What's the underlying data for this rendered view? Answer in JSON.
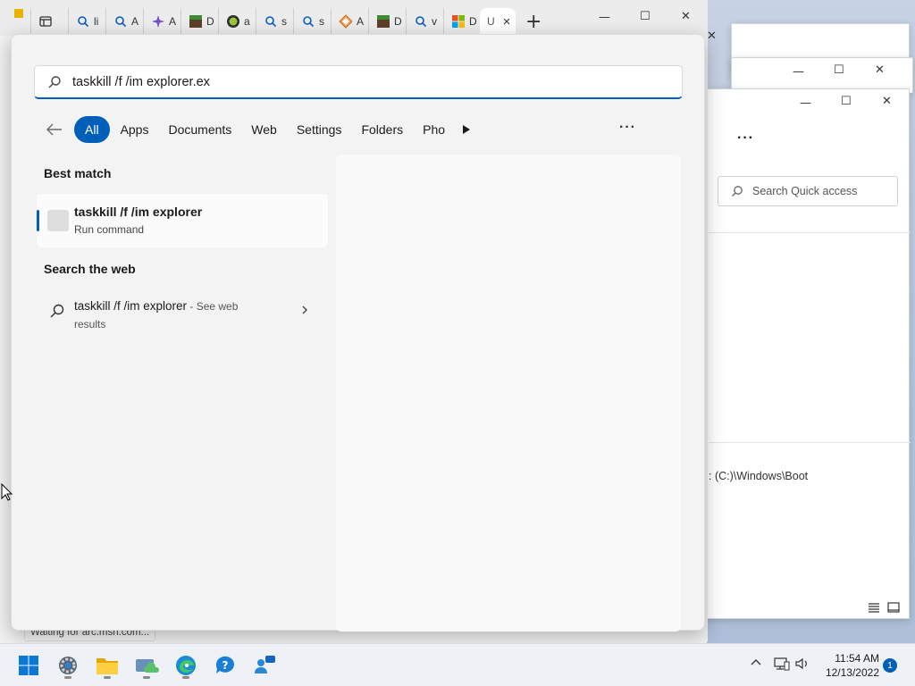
{
  "search": {
    "query": "taskkill /f /im explorer.ex"
  },
  "filters": {
    "back_icon": "arrow-left-icon",
    "chips": [
      {
        "label": "All",
        "active": true
      },
      {
        "label": "Apps"
      },
      {
        "label": "Documents"
      },
      {
        "label": "Web"
      },
      {
        "label": "Settings"
      },
      {
        "label": "Folders"
      },
      {
        "label": "Pho"
      }
    ],
    "more_icon": "play-triangle-icon",
    "overflow": "···"
  },
  "results": {
    "best_match_title": "Best match",
    "best_match": {
      "title": "taskkill /f /im explorer",
      "subtitle": "Run command"
    },
    "web_title": "Search the web",
    "web_item": {
      "text": "taskkill /f /im explorer",
      "suffix": " - See web results"
    }
  },
  "browser": {
    "tabs": [
      {
        "icon": "tab-view-icon",
        "letter": ""
      },
      {
        "icon": "search-icon",
        "letter": "li"
      },
      {
        "icon": "search-icon",
        "letter": "A"
      },
      {
        "icon": "sparkle-icon",
        "letter": "A"
      },
      {
        "icon": "minecraft-icon",
        "letter": "D"
      },
      {
        "icon": "xbox-icon",
        "letter": "a"
      },
      {
        "icon": "search-icon",
        "letter": "s"
      },
      {
        "icon": "search-icon",
        "letter": "s"
      },
      {
        "icon": "diamond-icon",
        "letter": "A"
      },
      {
        "icon": "minecraft-icon",
        "letter": "D"
      },
      {
        "icon": "search-icon",
        "letter": "v"
      },
      {
        "icon": "microsoft-icon",
        "letter": "D"
      }
    ],
    "active_tab": {
      "letter": "U",
      "close": "×"
    },
    "new_tab": "+",
    "status": "Waiting for arc.msn.com..."
  },
  "explorer": {
    "more": "···",
    "search_placeholder": "Search Quick access",
    "path": ": (C:)\\Windows\\Boot"
  },
  "taskbar": {
    "icons": [
      "windows-start-icon",
      "settings-gear-icon",
      "file-explorer-icon",
      "cloud-sync-icon",
      "edge-icon",
      "get-help-icon",
      "people-chat-icon"
    ],
    "time": "11:54 AM",
    "date": "12/13/2022",
    "notifications": "1"
  },
  "colors": {
    "accent": "#005fb8",
    "panel_bg": "#f3f3f3"
  }
}
